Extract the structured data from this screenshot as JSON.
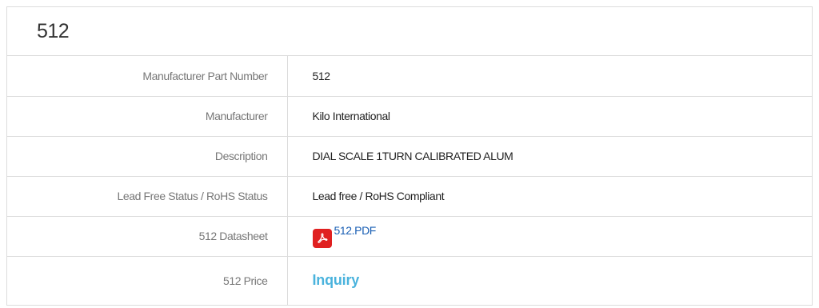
{
  "product": {
    "title": "512"
  },
  "specs": [
    {
      "label": "Manufacturer Part Number",
      "value": "512"
    },
    {
      "label": "Manufacturer",
      "value": "Kilo International"
    },
    {
      "label": "Description",
      "value": "DIAL SCALE 1TURN CALIBRATED ALUM"
    },
    {
      "label": "Lead Free Status / RoHS Status",
      "value": "Lead free / RoHS Compliant"
    }
  ],
  "datasheet": {
    "label": "512 Datasheet",
    "link_text": "512.PDF",
    "icon": "pdf-icon"
  },
  "price": {
    "label": "512 Price",
    "link_text": "Inquiry"
  },
  "colors": {
    "link": "#1a5fb4",
    "inquiry": "#4ab3dd",
    "pdf_icon": "#e02020",
    "border": "#dcdcdc"
  }
}
